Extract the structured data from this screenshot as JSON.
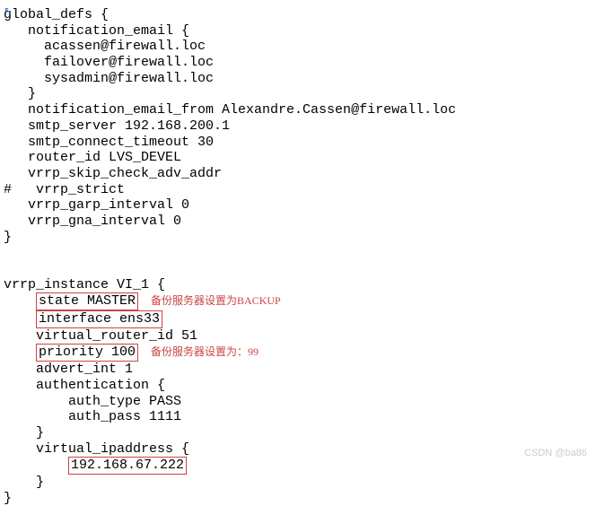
{
  "config": {
    "global_defs": {
      "open": "global_defs {",
      "notif_open": "   notification_email {",
      "emails": [
        "     acassen@firewall.loc",
        "     failover@firewall.loc",
        "     sysadmin@firewall.loc"
      ],
      "notif_close": "   }",
      "notif_from": "   notification_email_from Alexandre.Cassen@firewall.loc",
      "smtp_server": "   smtp_server 192.168.200.1",
      "smtp_timeout": "   smtp_connect_timeout 30",
      "router_id": "   router_id LVS_DEVEL",
      "skip_check": "   vrrp_skip_check_adv_addr",
      "strict": "#   vrrp_strict",
      "garp": "   vrrp_garp_interval 0",
      "gna": "   vrrp_gna_interval 0",
      "close": "}"
    },
    "vrrp": {
      "open": "vrrp_instance VI_1 {",
      "state_pre": "    ",
      "state_box": "state MASTER",
      "state_annot": "备份服务器设置为BACKUP",
      "iface_pre": "    ",
      "iface_box": "interface ens33",
      "vrid": "    virtual_router_id 51",
      "prio_pre": "    ",
      "prio_box": "priority 100",
      "prio_annot": "备份服务器设置为：99",
      "advert": "    advert_int 1",
      "auth_open": "    authentication {",
      "auth_type": "        auth_type PASS",
      "auth_pass": "        auth_pass 1111",
      "auth_close": "    }",
      "vip_open": "    virtual_ipaddress {",
      "vip_pre": "        ",
      "vip_box": "192.168.67.222",
      "vip_close": "    }",
      "close": "}"
    }
  },
  "watermark": "CSDN @ba86"
}
